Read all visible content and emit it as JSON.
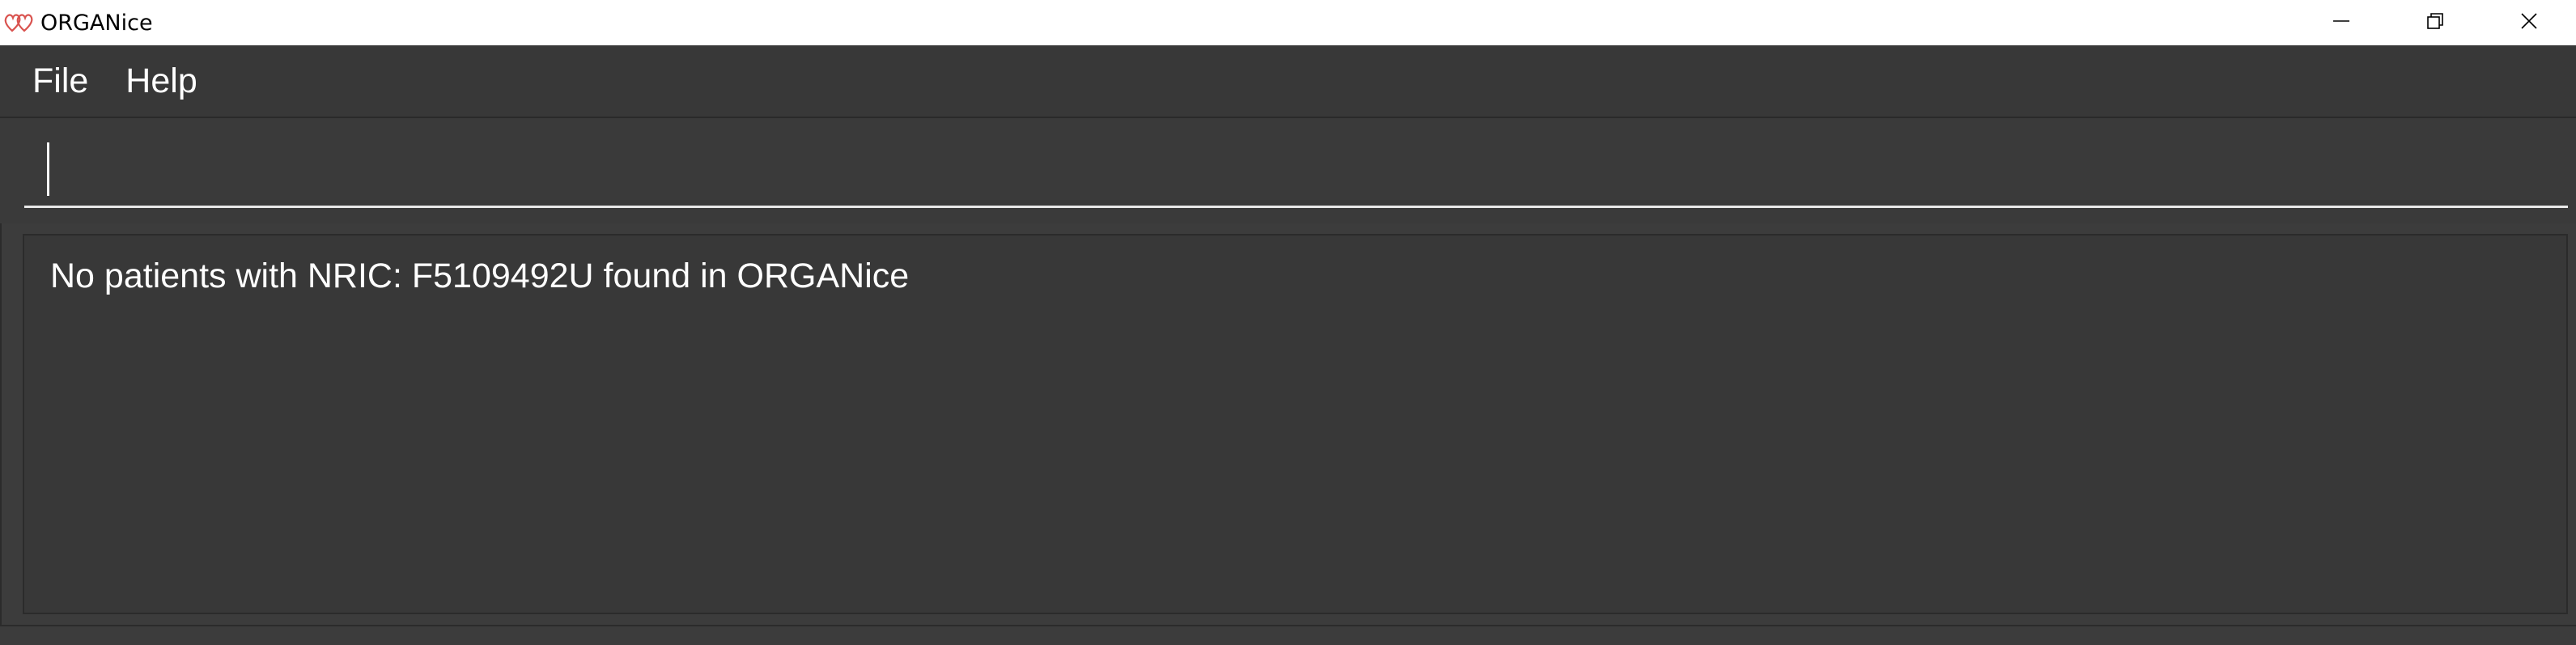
{
  "window": {
    "title": "ORGANice",
    "icon": "hearts-icon",
    "controls": [
      "minimize-icon",
      "restore-icon",
      "close-icon"
    ]
  },
  "menu": {
    "items": [
      "File",
      "Help"
    ]
  },
  "command": {
    "value": "",
    "placeholder": ""
  },
  "result": {
    "message": "No patients with NRIC: F5109492U found in ORGANice"
  },
  "colors": {
    "background": "#3c3c3c",
    "text": "#ffffff",
    "titlebar": "#ffffff",
    "icon_red": "#d9534f"
  }
}
